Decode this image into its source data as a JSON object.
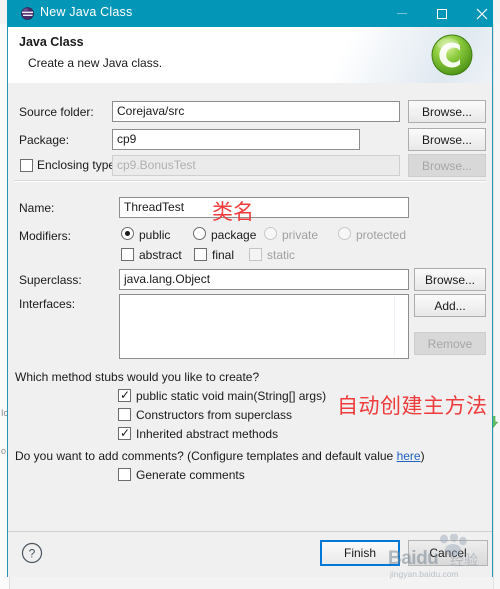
{
  "window": {
    "title": "New Java Class",
    "icon": "eclipse-java-icon",
    "buttons": {
      "minimize": "minimize-icon",
      "maximize": "maximize-icon",
      "close": "close-icon"
    },
    "titlebar_color": "#0496b7"
  },
  "header": {
    "title": "Java Class",
    "subtitle": "Create a new Java class.",
    "logo": "eclipse-c-logo"
  },
  "form": {
    "source_folder": {
      "label": "Source folder:",
      "value": "Corejava/src",
      "browse": "Browse..."
    },
    "package": {
      "label": "Package:",
      "value": "cp9",
      "browse": "Browse..."
    },
    "enclosing_type": {
      "label": "Enclosing type:",
      "value": "cp9.BonusTest",
      "checked": false,
      "browse": "Browse..."
    },
    "name": {
      "label": "Name:",
      "value": "ThreadTest"
    },
    "modifiers": {
      "label": "Modifiers:",
      "access": [
        {
          "label": "public",
          "selected": true,
          "enabled": true
        },
        {
          "label": "package",
          "selected": false,
          "enabled": true
        },
        {
          "label": "private",
          "selected": false,
          "enabled": false
        },
        {
          "label": "protected",
          "selected": false,
          "enabled": false
        }
      ],
      "flags": [
        {
          "label": "abstract",
          "checked": false,
          "enabled": true
        },
        {
          "label": "final",
          "checked": false,
          "enabled": true
        },
        {
          "label": "static",
          "checked": false,
          "enabled": false
        }
      ]
    },
    "superclass": {
      "label": "Superclass:",
      "value": "java.lang.Object",
      "browse": "Browse..."
    },
    "interfaces": {
      "label": "Interfaces:",
      "items": [],
      "add": "Add...",
      "remove": "Remove"
    },
    "stubs": {
      "question": "Which method stubs would you like to create?",
      "options": [
        {
          "label": "public static void main(String[] args)",
          "checked": true
        },
        {
          "label": "Constructors from superclass",
          "checked": false
        },
        {
          "label": "Inherited abstract methods",
          "checked": true
        }
      ]
    },
    "comments": {
      "question_prefix": "Do you want to add comments? (Configure templates and default value ",
      "link": "here",
      "question_suffix": ")",
      "option": {
        "label": "Generate comments",
        "checked": false
      }
    }
  },
  "footer": {
    "help": "help-icon",
    "finish": "Finish",
    "cancel": "Cancel"
  },
  "annotations": [
    {
      "text": "类名",
      "color": "#ef3b3b",
      "target": "name-field"
    },
    {
      "text": "自动创建主方法",
      "color": "#ef3b3b",
      "target": "main-method-checkbox"
    }
  ],
  "watermark": {
    "brand": "Baidu",
    "suffix": "经验",
    "url": "jingyan.baidu.com"
  },
  "background": {
    "ghost_left": [
      "Ic",
      "o"
    ],
    "ghost_arrow": "green-down-arrow-icon"
  }
}
